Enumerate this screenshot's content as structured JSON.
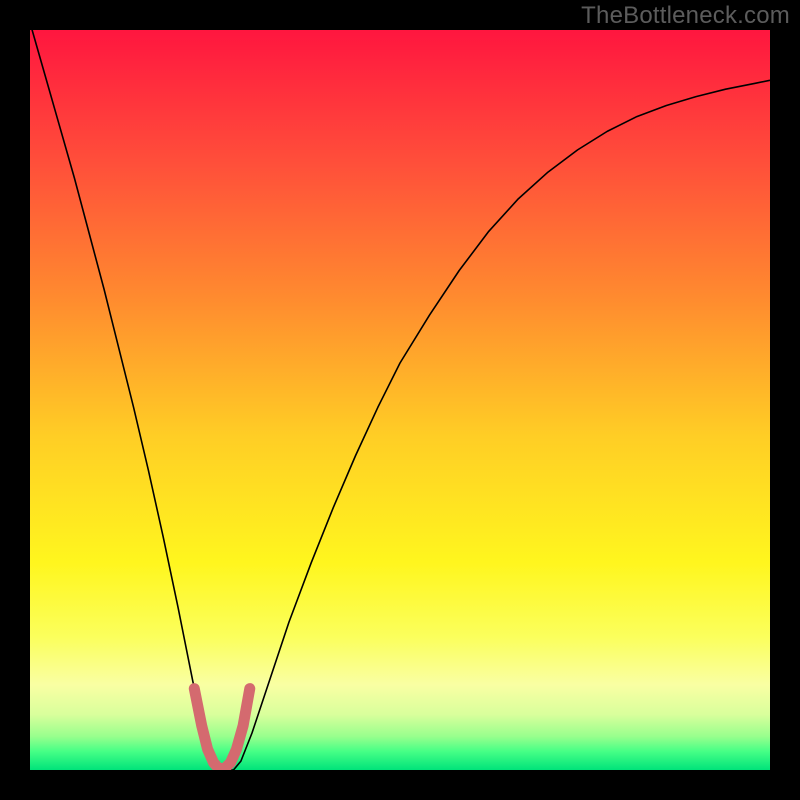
{
  "branding": {
    "watermark": "TheBottleneck.com"
  },
  "chart_data": {
    "type": "line",
    "title": "",
    "xlabel": "",
    "ylabel": "",
    "xlim": [
      0,
      100
    ],
    "ylim": [
      0,
      100
    ],
    "background_gradient": {
      "stops": [
        {
          "offset": 0,
          "color": "#ff163f"
        },
        {
          "offset": 0.18,
          "color": "#ff4f3a"
        },
        {
          "offset": 0.36,
          "color": "#ff8a2f"
        },
        {
          "offset": 0.55,
          "color": "#ffce25"
        },
        {
          "offset": 0.72,
          "color": "#fff61e"
        },
        {
          "offset": 0.82,
          "color": "#fbff5c"
        },
        {
          "offset": 0.885,
          "color": "#f9ffa3"
        },
        {
          "offset": 0.925,
          "color": "#d9ff9c"
        },
        {
          "offset": 0.955,
          "color": "#97ff8d"
        },
        {
          "offset": 0.975,
          "color": "#46ff86"
        },
        {
          "offset": 1.0,
          "color": "#00e37a"
        }
      ]
    },
    "series": [
      {
        "name": "bottleneck-curve",
        "color": "#000000",
        "width": 1.6,
        "x": [
          0,
          2,
          4,
          6,
          8,
          10,
          12,
          14,
          16,
          18,
          20,
          22,
          23.5,
          24.5,
          25.5,
          26.5,
          27.5,
          28.5,
          30,
          32.5,
          35,
          38,
          41,
          44,
          47,
          50,
          54,
          58,
          62,
          66,
          70,
          74,
          78,
          82,
          86,
          90,
          94,
          98,
          100
        ],
        "y": [
          101,
          94,
          87,
          80,
          72.5,
          65,
          57,
          49,
          40.5,
          31.5,
          22,
          12,
          5,
          1.2,
          0,
          0,
          0,
          1.2,
          5,
          12.5,
          20,
          28,
          35.5,
          42.5,
          49,
          55,
          61.5,
          67.5,
          72.8,
          77.2,
          80.8,
          83.8,
          86.3,
          88.3,
          89.8,
          91,
          92,
          92.8,
          93.2
        ]
      },
      {
        "name": "optimal-range-highlight",
        "color": "#d46a6f",
        "width": 11,
        "linecap": "round",
        "x": [
          22.2,
          23.2,
          24.0,
          24.8,
          25.5,
          26.3,
          27.1,
          27.9,
          28.8,
          29.7
        ],
        "y": [
          11.0,
          6.0,
          2.8,
          1.0,
          0.2,
          0.2,
          1.0,
          2.8,
          6.0,
          11.0
        ]
      }
    ],
    "annotations": []
  }
}
